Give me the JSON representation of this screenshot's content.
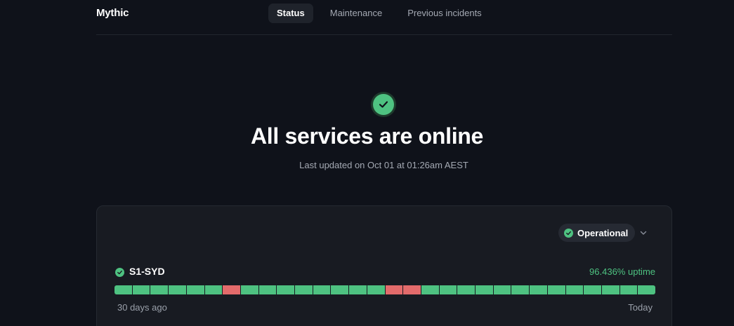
{
  "header": {
    "brand": "Mythic",
    "tabs": [
      {
        "label": "Status",
        "active": true
      },
      {
        "label": "Maintenance",
        "active": false
      },
      {
        "label": "Previous incidents",
        "active": false
      }
    ]
  },
  "hero": {
    "icon": "check-circle-icon",
    "title": "All services are online",
    "subtitle": "Last updated on Oct 01 at 01:26am AEST"
  },
  "service_group": {
    "status_label": "Operational",
    "status_icon": "check-circle-icon",
    "expand_icon": "chevron-down-icon",
    "services": [
      {
        "name": "S1-SYD",
        "uptime": "96.436% uptime",
        "range_start": "30 days ago",
        "range_end": "Today",
        "days": [
          "up",
          "up",
          "up",
          "up",
          "up",
          "up",
          "down",
          "up",
          "up",
          "up",
          "up",
          "up",
          "up",
          "up",
          "up",
          "down",
          "down",
          "up",
          "up",
          "up",
          "up",
          "up",
          "up",
          "up",
          "up",
          "up",
          "up",
          "up",
          "up",
          "up"
        ]
      }
    ]
  },
  "colors": {
    "background": "#0f121a",
    "card": "#181b22",
    "operational": "#4ec281",
    "outage": "#e36b6b"
  }
}
